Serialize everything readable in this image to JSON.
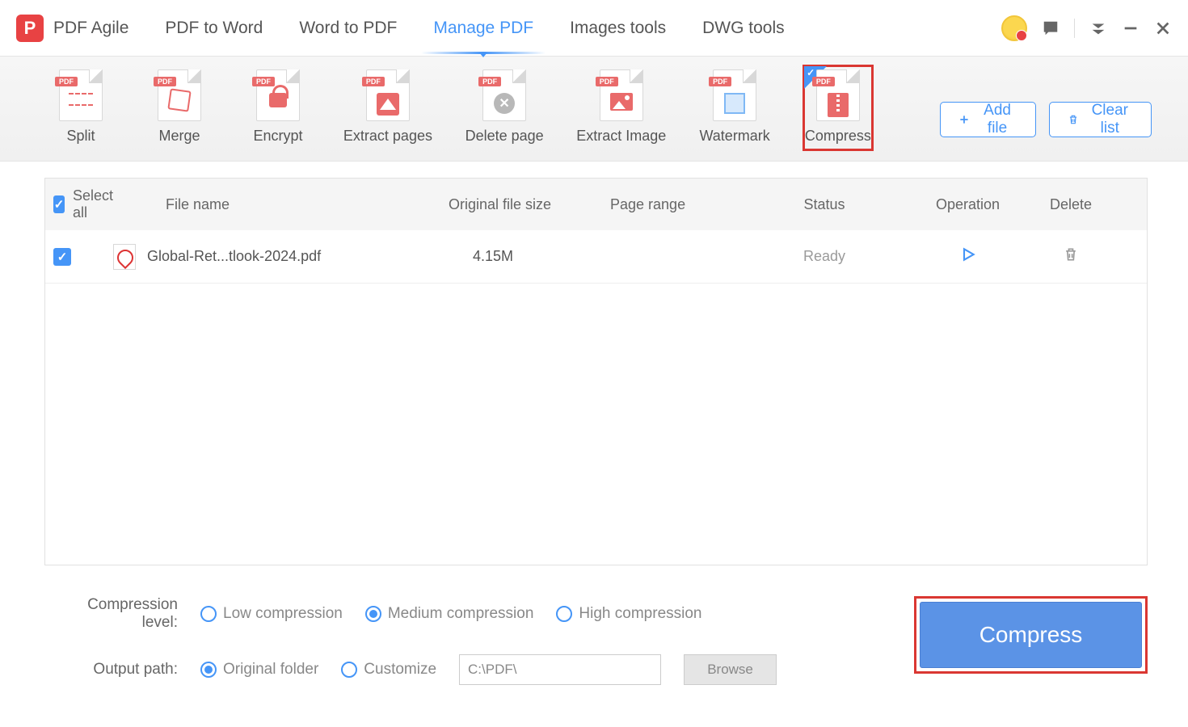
{
  "app": {
    "name": "PDF Agile"
  },
  "nav": {
    "items": [
      {
        "label": "PDF to Word"
      },
      {
        "label": "Word to PDF"
      },
      {
        "label": "Manage PDF",
        "active": true
      },
      {
        "label": "Images tools"
      },
      {
        "label": "DWG tools"
      }
    ]
  },
  "toolbar": {
    "tools": {
      "split": "Split",
      "merge": "Merge",
      "encrypt": "Encrypt",
      "extract_pages": "Extract pages",
      "delete_page": "Delete page",
      "extract_image": "Extract Image",
      "watermark": "Watermark",
      "compress": "Compress"
    },
    "add_file": "Add file",
    "clear_list": "Clear list"
  },
  "table": {
    "select_all": "Select all",
    "headers": {
      "file_name": "File name",
      "original_size": "Original file size",
      "page_range": "Page range",
      "status": "Status",
      "operation": "Operation",
      "delete": "Delete"
    },
    "rows": [
      {
        "name": "Global-Ret...tlook-2024.pdf",
        "size": "4.15M",
        "page_range": "",
        "status": "Ready"
      }
    ]
  },
  "options": {
    "compression_label": "Compression level:",
    "low": "Low compression",
    "medium": "Medium compression",
    "high": "High compression",
    "output_label": "Output path:",
    "original_folder": "Original folder",
    "customize": "Customize",
    "path_value": "C:\\PDF\\",
    "browse": "Browse"
  },
  "actions": {
    "compress": "Compress"
  }
}
